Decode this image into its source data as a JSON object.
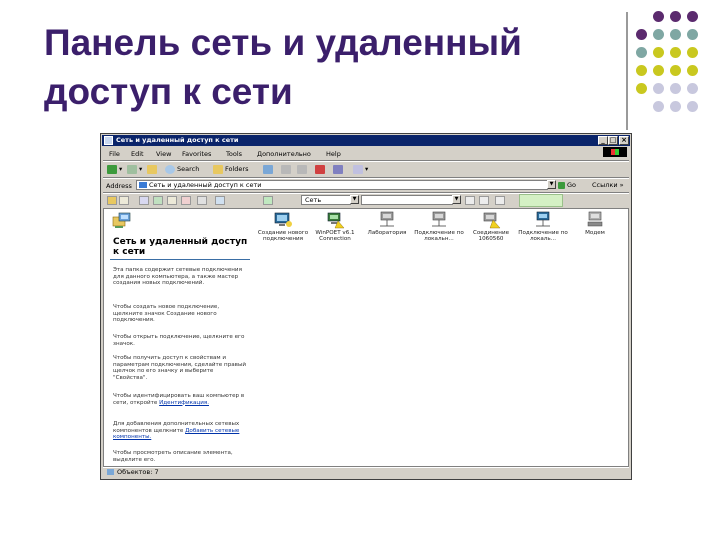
{
  "slide": {
    "title": "Панель сеть и удаленный доступ к сети",
    "accent_color": "#3b1f6b",
    "dot_colors": {
      "purple": "#5b2a6e",
      "teal": "#7fa7a3",
      "olive": "#c9c81f",
      "lilac": "#c8c8de"
    }
  },
  "window": {
    "title": "Сеть и удаленный доступ к сети",
    "minimize": "_",
    "maximize": "□",
    "close": "×",
    "menu": [
      "File",
      "Edit",
      "View",
      "Favorites",
      "Tools",
      "Дополнительно",
      "Help"
    ],
    "toolbar": {
      "search": "Search",
      "folders": "Folders"
    },
    "address": {
      "label": "Address",
      "value": "Сеть и удаленный доступ к сети",
      "go": "Go",
      "links": "Ссылки"
    },
    "toolbar2": {
      "combo1": "Сеть"
    },
    "left_pane": {
      "title": "Сеть и удаленный доступ к сети",
      "paragraphs": [
        "Эта папка содержит сетевые подключения для данного компьютера, а также мастер создания новых подключений.",
        "Чтобы создать новое подключение, щелкните значок Создание нового подключения.",
        "Чтобы открыть подключение, щелкните его значок.",
        "Чтобы получить доступ к свойствам и параметрам подключения, сделайте правый щелчок по его значку и выберите \"Свойства\"."
      ],
      "link_paragraphs": [
        {
          "text": "Чтобы идентифицировать ваш компьютер в сети, откройте",
          "link": "Идентификация."
        },
        {
          "text": "Для добавления дополнительных сетевых компонентов щелкните",
          "link": "Добавить сетевые компоненты."
        }
      ],
      "last_paragraph": "Чтобы просмотреть описание элемента, выделите его."
    },
    "icons": [
      {
        "label": "Создание нового подключения"
      },
      {
        "label": "WinPOET v6.1 Connection"
      },
      {
        "label": "Лаборатория"
      },
      {
        "label": "Подключение по локальн..."
      },
      {
        "label": "Соединение 1060560"
      },
      {
        "label": "Подключение по локаль..."
      },
      {
        "label": "Модем"
      }
    ],
    "status": "Объектов: 7"
  }
}
